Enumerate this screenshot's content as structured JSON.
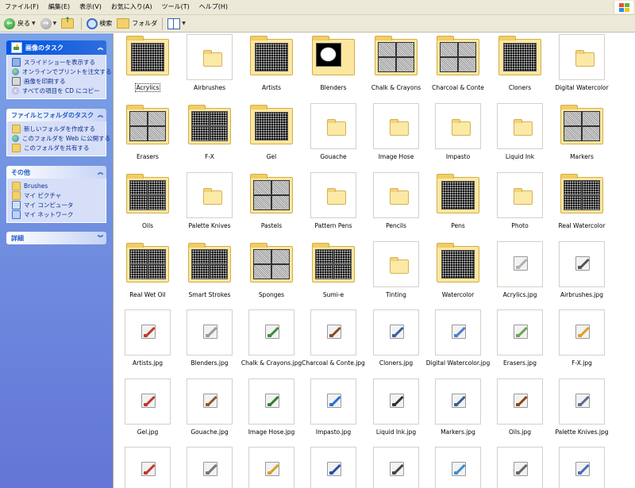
{
  "menu": {
    "items": [
      "ファイル(F)",
      "編集(E)",
      "表示(V)",
      "お気に入り(A)",
      "ツール(T)",
      "ヘルプ(H)"
    ]
  },
  "toolbar": {
    "back_label": "戻る",
    "search_label": "検索",
    "folders_label": "フォルダ"
  },
  "left_pane": {
    "picture_tasks": {
      "title": "画像のタスク",
      "items": [
        "スライドショーを表示する",
        "オンラインでプリントを注文する",
        "画像を印刷する",
        "すべての項目を CD にコピー"
      ]
    },
    "file_tasks": {
      "title": "ファイルとフォルダのタスク",
      "items": [
        "新しいフォルダを作成する",
        "このフォルダを Web に公開する",
        "このフォルダを共有する"
      ]
    },
    "other_places": {
      "title": "その他",
      "items": [
        "Brushes",
        "マイ ピクチャ",
        "マイ コンピュータ",
        "マイ ネットワーク"
      ]
    },
    "details": {
      "title": "詳細"
    }
  },
  "items": [
    {
      "label": "Acrylics",
      "kind": "folder",
      "preview": "black",
      "selected": true
    },
    {
      "label": "Airbrushes",
      "kind": "folder-empty"
    },
    {
      "label": "Artists",
      "kind": "folder",
      "preview": "black"
    },
    {
      "label": "Blenders",
      "kind": "folder",
      "preview": "white"
    },
    {
      "label": "Chalk & Crayons",
      "kind": "folder",
      "preview": "quad-gray"
    },
    {
      "label": "Charcoal & Conte",
      "kind": "folder",
      "preview": "quad-gray"
    },
    {
      "label": "Cloners",
      "kind": "folder",
      "preview": "black"
    },
    {
      "label": "Digital Watercolor",
      "kind": "folder-empty"
    },
    {
      "label": "Erasers",
      "kind": "folder",
      "preview": "quad-gray"
    },
    {
      "label": "F-X",
      "kind": "folder",
      "preview": "quad-black"
    },
    {
      "label": "Gel",
      "kind": "folder",
      "preview": "black"
    },
    {
      "label": "Gouache",
      "kind": "folder-empty"
    },
    {
      "label": "Image Hose",
      "kind": "folder-empty"
    },
    {
      "label": "Impasto",
      "kind": "folder-empty"
    },
    {
      "label": "Liquid Ink",
      "kind": "folder-empty"
    },
    {
      "label": "Markers",
      "kind": "folder",
      "preview": "quad-gray"
    },
    {
      "label": "Oils",
      "kind": "folder",
      "preview": "quad-black"
    },
    {
      "label": "Palette Knives",
      "kind": "folder-empty"
    },
    {
      "label": "Pastels",
      "kind": "folder",
      "preview": "quad-gray"
    },
    {
      "label": "Pattern Pens",
      "kind": "folder-empty"
    },
    {
      "label": "Pencils",
      "kind": "folder-empty"
    },
    {
      "label": "Pens",
      "kind": "folder",
      "preview": "black"
    },
    {
      "label": "Photo",
      "kind": "folder-empty"
    },
    {
      "label": "Real Watercolor",
      "kind": "folder",
      "preview": "quad-black"
    },
    {
      "label": "Real Wet Oil",
      "kind": "folder",
      "preview": "quad-black"
    },
    {
      "label": "Smart Strokes",
      "kind": "folder",
      "preview": "quad-black"
    },
    {
      "label": "Sponges",
      "kind": "folder",
      "preview": "quad-gray"
    },
    {
      "label": "Sumi-e",
      "kind": "folder",
      "preview": "quad-black"
    },
    {
      "label": "Tinting",
      "kind": "folder-empty"
    },
    {
      "label": "Watercolor",
      "kind": "folder",
      "preview": "black"
    },
    {
      "label": "Acrylics.jpg",
      "kind": "jpg",
      "color": "#b0b0b0"
    },
    {
      "label": "Airbrushes.jpg",
      "kind": "jpg",
      "color": "#555555"
    },
    {
      "label": "Artists.jpg",
      "kind": "jpg",
      "color": "#c0392b"
    },
    {
      "label": "Blenders.jpg",
      "kind": "jpg",
      "color": "#9a9a9a"
    },
    {
      "label": "Chalk & Crayons.jpg",
      "kind": "jpg",
      "color": "#3d8b3d"
    },
    {
      "label": "Charcoal & Conte.jpg",
      "kind": "jpg",
      "color": "#8a4b2a"
    },
    {
      "label": "Cloners.jpg",
      "kind": "jpg",
      "color": "#3b5ea8"
    },
    {
      "label": "Digital Watercolor.jpg",
      "kind": "jpg",
      "color": "#4a7fd1"
    },
    {
      "label": "Erasers.jpg",
      "kind": "jpg",
      "color": "#6aa84f"
    },
    {
      "label": "F-X.jpg",
      "kind": "jpg",
      "color": "#e0a020"
    },
    {
      "label": "Gel.jpg",
      "kind": "jpg",
      "color": "#c0392b"
    },
    {
      "label": "Gouache.jpg",
      "kind": "jpg",
      "color": "#8b5a2b"
    },
    {
      "label": "Image Hose.jpg",
      "kind": "jpg",
      "color": "#2e7d32"
    },
    {
      "label": "Impasto.jpg",
      "kind": "jpg",
      "color": "#2a6fd1"
    },
    {
      "label": "Liquid Ink.jpg",
      "kind": "jpg",
      "color": "#333333"
    },
    {
      "label": "Markers.jpg",
      "kind": "jpg",
      "color": "#3d5c99"
    },
    {
      "label": "Oils.jpg",
      "kind": "jpg",
      "color": "#8b4513"
    },
    {
      "label": "Palette Knives.jpg",
      "kind": "jpg",
      "color": "#5a6b8c"
    },
    {
      "label": "",
      "kind": "jpg",
      "color": "#c0392b"
    },
    {
      "label": "",
      "kind": "jpg",
      "color": "#777777"
    },
    {
      "label": "",
      "kind": "jpg",
      "color": "#d4a020"
    },
    {
      "label": "",
      "kind": "jpg",
      "color": "#2a4fa8"
    },
    {
      "label": "",
      "kind": "jpg",
      "color": "#444444"
    },
    {
      "label": "",
      "kind": "jpg",
      "color": "#3a8fd1"
    },
    {
      "label": "",
      "kind": "jpg",
      "color": "#666666"
    },
    {
      "label": "",
      "kind": "jpg",
      "color": "#4a6bc1"
    }
  ]
}
